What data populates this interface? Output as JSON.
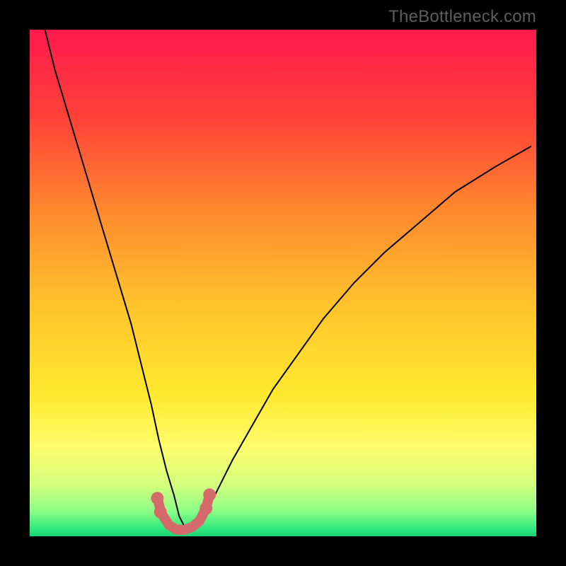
{
  "watermark": "TheBottleneck.com",
  "chart_data": {
    "type": "line",
    "title": "",
    "xlabel": "",
    "ylabel": "",
    "xlim": [
      0,
      100
    ],
    "ylim": [
      0,
      100
    ],
    "grid": false,
    "legend": false,
    "background_gradient_stops": [
      {
        "offset": 0.0,
        "color": "#ff1a4d"
      },
      {
        "offset": 0.18,
        "color": "#ff4338"
      },
      {
        "offset": 0.36,
        "color": "#ff8a2e"
      },
      {
        "offset": 0.54,
        "color": "#ffc22c"
      },
      {
        "offset": 0.72,
        "color": "#ffe92e"
      },
      {
        "offset": 0.82,
        "color": "#fffc6a"
      },
      {
        "offset": 0.9,
        "color": "#d2ff7e"
      },
      {
        "offset": 0.95,
        "color": "#8dff86"
      },
      {
        "offset": 0.985,
        "color": "#2fe87e"
      },
      {
        "offset": 1.0,
        "color": "#19d67a"
      }
    ],
    "series": [
      {
        "name": "bottleneck-curve",
        "color": "#000000",
        "stroke_width": 2,
        "x": [
          3,
          5,
          8,
          11,
          14,
          17,
          20,
          22,
          24,
          25.5,
          27,
          28.5,
          29.5,
          30.5,
          31.5,
          33,
          35,
          37,
          40,
          44,
          48,
          53,
          58,
          64,
          70,
          77,
          84,
          92,
          99
        ],
        "y": [
          100,
          92,
          82,
          72,
          62,
          52,
          42,
          34,
          26,
          19,
          13,
          8,
          4,
          2,
          1,
          2,
          5,
          9,
          15,
          22,
          29,
          36,
          43,
          50,
          56,
          62,
          68,
          73,
          77
        ]
      },
      {
        "name": "bottom-bracket",
        "color": "#d46a6a",
        "stroke_width": 14,
        "linecap": "round",
        "x": [
          25.2,
          26.0,
          27.5,
          29.0,
          30.5,
          32.0,
          33.5,
          34.8,
          35.5
        ],
        "y": [
          7.5,
          4.5,
          2.2,
          1.3,
          1.3,
          1.8,
          3.0,
          5.5,
          8.2
        ]
      }
    ],
    "marker_dots": {
      "name": "bracket-end-dots",
      "color": "#d46a6a",
      "radius": 9,
      "points": [
        {
          "x": 25.2,
          "y": 7.5
        },
        {
          "x": 25.8,
          "y": 4.8
        },
        {
          "x": 34.8,
          "y": 5.5
        },
        {
          "x": 35.5,
          "y": 8.2
        }
      ]
    }
  }
}
